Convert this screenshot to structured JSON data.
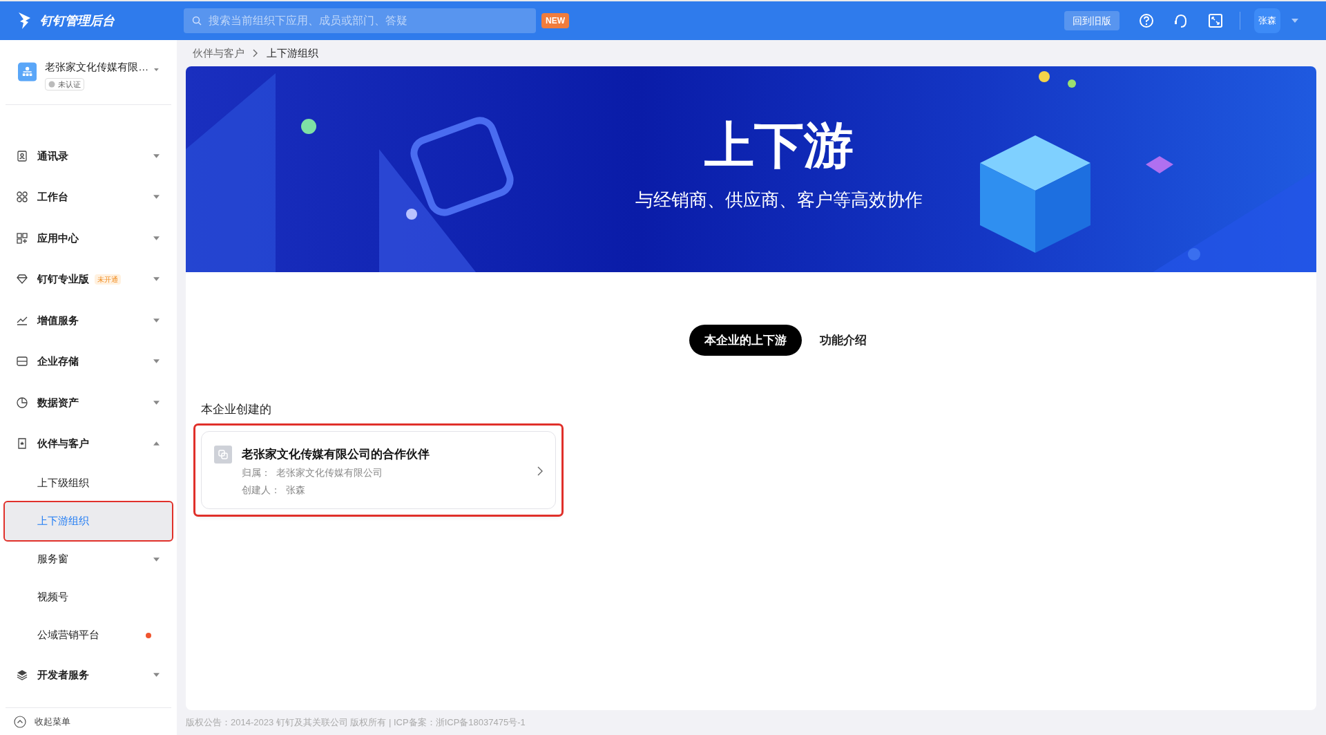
{
  "header": {
    "app_title": "钉钉管理后台",
    "search": {
      "placeholder": "搜索当前组织下应用、成员或部门、答疑"
    },
    "new_badge": "NEW",
    "old_version_button": "回到旧版",
    "user": "张森"
  },
  "org": {
    "name": "老张家文化传媒有限…",
    "certification": "未认证"
  },
  "sidebar": {
    "items": [
      {
        "kind": "group",
        "label": "通讯录",
        "expanded": false
      },
      {
        "kind": "group",
        "label": "工作台",
        "expanded": false
      },
      {
        "kind": "group",
        "label": "应用中心",
        "expanded": false
      },
      {
        "kind": "group",
        "label": "钉钉专业版",
        "badge": "未开通",
        "expanded": false
      },
      {
        "kind": "group",
        "label": "增值服务",
        "expanded": false
      },
      {
        "kind": "group",
        "label": "企业存储",
        "expanded": false
      },
      {
        "kind": "group",
        "label": "数据资产",
        "expanded": false
      },
      {
        "kind": "group",
        "label": "伙伴与客户",
        "expanded": true
      },
      {
        "kind": "sub",
        "label": "上下级组织",
        "selected": false,
        "highlighted": false
      },
      {
        "kind": "sub",
        "label": "上下游组织",
        "selected": true,
        "highlighted": true
      },
      {
        "kind": "sub",
        "label": "服务窗",
        "expanded": false,
        "selected": false,
        "highlighted": false
      },
      {
        "kind": "sub",
        "label": "视频号",
        "selected": false,
        "highlighted": false
      },
      {
        "kind": "sub",
        "label": "公域营销平台",
        "dot": true,
        "selected": false,
        "highlighted": false
      },
      {
        "kind": "group",
        "label": "开发者服务",
        "expanded": false
      }
    ],
    "collapse": "收起菜单"
  },
  "breadcrumb": [
    "伙伴与客户",
    "上下游组织"
  ],
  "banner": {
    "title": "上下游",
    "subtitle": "与经销商、供应商、客户等高效协作"
  },
  "tabs": [
    {
      "label": "本企业的上下游",
      "selected": true
    },
    {
      "label": "功能介绍",
      "selected": false
    }
  ],
  "section_title": "本企业创建的",
  "cards": [
    {
      "title": "老张家文化传媒有限公司的合作伙伴",
      "owner": "归属：  老张家文化传媒有限公司",
      "creator": "创建人：  张森",
      "highlighted": true
    }
  ],
  "footer": "版权公告：2014-2023 钉钉及其关联公司 版权所有 | ICP备案：浙ICP备18037475号-1"
}
